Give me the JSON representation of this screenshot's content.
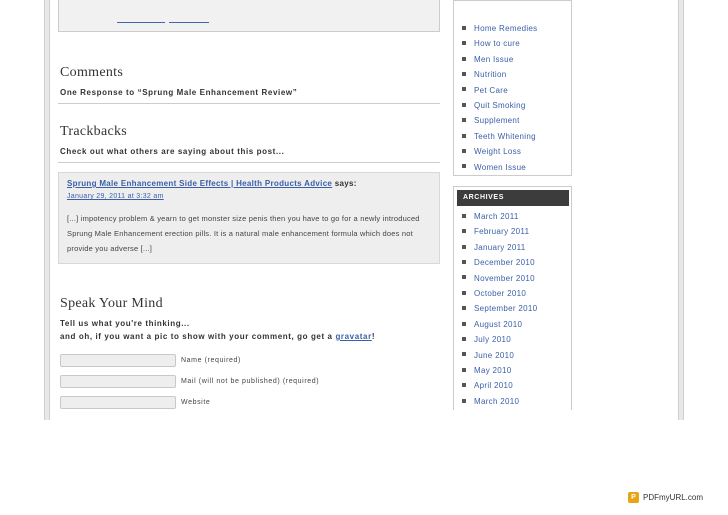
{
  "comments": {
    "heading": "Comments",
    "response_count": "One Response to “Sprung Male Enhancement Review”"
  },
  "trackbacks": {
    "heading": "Trackbacks",
    "intro": "Check out what others are saying about this post...",
    "items": [
      {
        "author": "Sprung Male Enhancement Side Effects | Health Products Advice",
        "says": "says:",
        "date": "January 29, 2011 at 3:32 am",
        "text": "[...] impotency problem & yearn to get monster size penis then you have to go for a newly introduced Sprung Male Enhancement erection pills. It is a natural male enhancement formula which does not provide you adverse [...]"
      }
    ]
  },
  "speak": {
    "heading": "Speak Your Mind",
    "line1": "Tell us what you're thinking...",
    "line2_prefix": "and oh, if you want a pic to show with your comment, go get a ",
    "line2_link": "gravatar",
    "line2_suffix": "!",
    "fields": [
      {
        "label": "Name (required)",
        "value": ""
      },
      {
        "label": "Mail (will not be published) (required)",
        "value": ""
      },
      {
        "label": "Website",
        "value": ""
      }
    ]
  },
  "sidebar": {
    "categories": [
      "Home Remedies",
      "How to cure",
      "Men Issue",
      "Nutrition",
      "Pet Care",
      "Quit Smoking",
      "Supplement",
      "Teeth Whitening",
      "Weight Loss",
      "Women Issue"
    ],
    "archives_heading": "ARCHIVES",
    "archives": [
      "March 2011",
      "February 2011",
      "January 2011",
      "December 2010",
      "November 2010",
      "October 2010",
      "September 2010",
      "August 2010",
      "July 2010",
      "June 2010",
      "May 2010",
      "April 2010",
      "March 2010"
    ]
  },
  "badge": {
    "label": "PDFmyURL.com",
    "icon": "pdf-icon"
  }
}
